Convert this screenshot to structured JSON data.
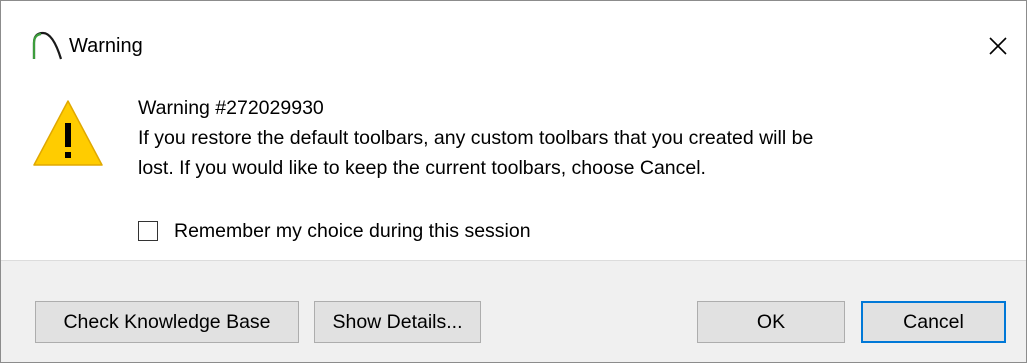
{
  "window": {
    "title": "Warning",
    "app_icon": "arch-app-icon",
    "close_icon": "close-icon"
  },
  "message": {
    "icon": "warning-triangle-icon",
    "heading": "Warning #272029930",
    "line1": "If you restore the default toolbars, any custom toolbars that you created will be",
    "line2": "lost. If you would like to keep the current toolbars, choose Cancel."
  },
  "remember": {
    "label": "Remember my choice during this session",
    "checked": false
  },
  "buttons": {
    "knowledge_base": "Check Knowledge Base",
    "show_details": "Show Details...",
    "ok": "OK",
    "cancel": "Cancel"
  },
  "colors": {
    "warning_yellow": "#ffcc00",
    "app_icon_green": "#3c9d3c",
    "focus_blue": "#0078d7",
    "footer_bg": "#f0f0f0"
  }
}
